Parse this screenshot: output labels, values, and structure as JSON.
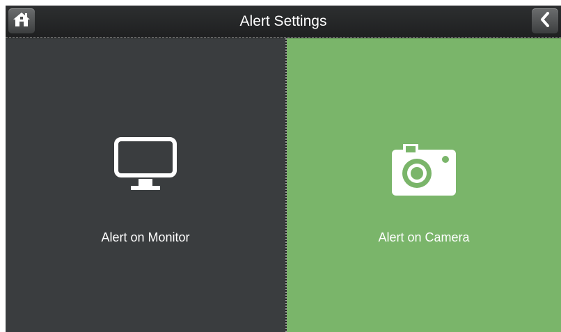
{
  "header": {
    "title": "Alert Settings",
    "home_icon": "home-icon",
    "back_icon": "chevron-left-icon"
  },
  "options": [
    {
      "label": "Alert on Monitor",
      "icon": "monitor-icon",
      "color": "#3a3d3f"
    },
    {
      "label": "Alert on Camera",
      "icon": "camera-icon",
      "color": "#7ab56a"
    }
  ]
}
